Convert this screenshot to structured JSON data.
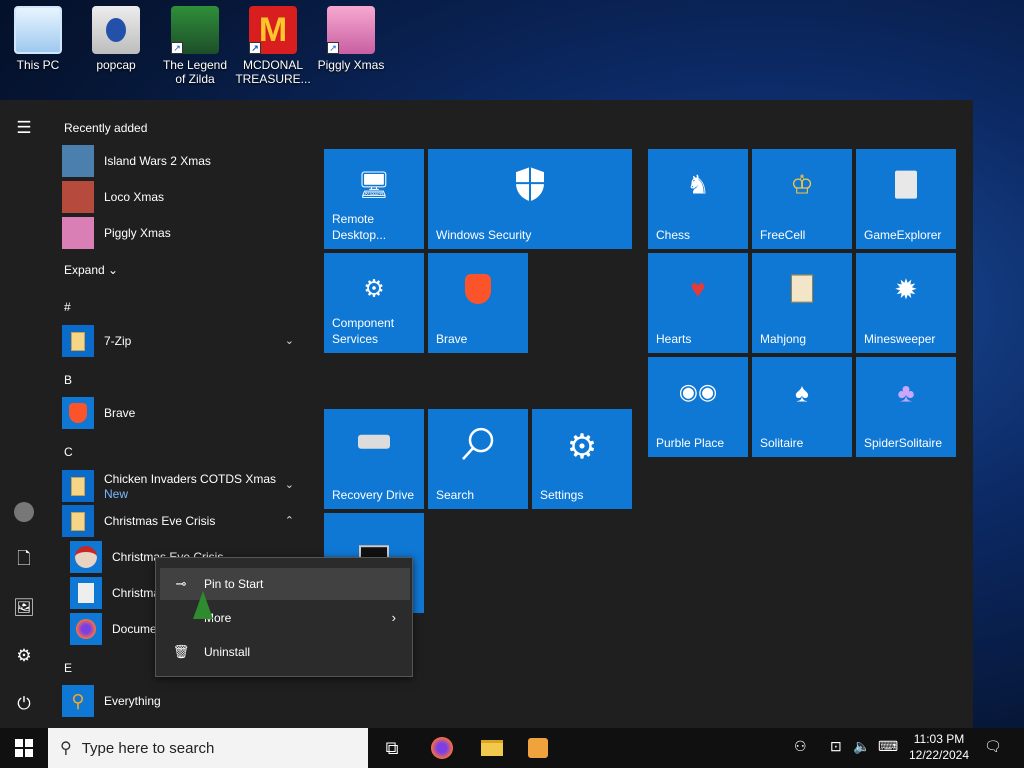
{
  "desktop": {
    "icons": [
      {
        "label": "This PC"
      },
      {
        "label": "popcap"
      },
      {
        "label": "The Legend of Zilda"
      },
      {
        "label": "MCDONAL TREASURE..."
      },
      {
        "label": "Piggly Xmas"
      }
    ]
  },
  "start_menu": {
    "recently_added_header": "Recently added",
    "recent_apps": [
      {
        "label": "Island Wars 2 Xmas"
      },
      {
        "label": "Loco Xmas"
      },
      {
        "label": "Piggly Xmas"
      }
    ],
    "expand_label": "Expand",
    "sections": {
      "hash": "#",
      "b": "B",
      "c": "C",
      "e": "E"
    },
    "apps": {
      "seven_zip": "7-Zip",
      "brave": "Brave",
      "chicken_invaders": "Chicken Invaders COTDS Xmas",
      "chicken_invaders_badge": "New",
      "christmas_eve_crisis": "Christmas Eve Crisis",
      "sub1": "Christmas Eve Crisis",
      "sub2": "Christmas...",
      "sub3": "Documentation",
      "everything": "Everything"
    },
    "tiles": [
      {
        "label": "Remote Desktop...",
        "icon": "remote-desktop-icon"
      },
      {
        "label": "Windows Security",
        "icon": "shield-icon"
      },
      {
        "label": "Component Services",
        "icon": "component-services-icon"
      },
      {
        "label": "Brave",
        "icon": "brave-icon"
      },
      {
        "label": "Recovery Drive",
        "icon": "drive-icon"
      },
      {
        "label": "Search",
        "icon": "search-icon"
      },
      {
        "label": "Settings",
        "icon": "gear-icon"
      },
      {
        "label": "Chess",
        "icon": "chess-icon"
      },
      {
        "label": "FreeCell",
        "icon": "freecell-icon"
      },
      {
        "label": "GameExplorer",
        "icon": "game-explorer-icon"
      },
      {
        "label": "Hearts",
        "icon": "hearts-icon"
      },
      {
        "label": "Mahjong",
        "icon": "mahjong-icon"
      },
      {
        "label": "Minesweeper",
        "icon": "mine-icon"
      },
      {
        "label": "Purble Place",
        "icon": "purble-icon"
      },
      {
        "label": "Solitaire",
        "icon": "solitaire-icon"
      },
      {
        "label": "SpiderSolitaire",
        "icon": "spider-solitaire-icon"
      }
    ]
  },
  "context_menu": {
    "items": [
      {
        "label": "Pin to Start"
      },
      {
        "label": "More"
      },
      {
        "label": "Uninstall"
      }
    ]
  },
  "taskbar": {
    "search_placeholder": "Type here to search",
    "clock_time": "11:03 PM",
    "clock_date": "12/22/2024"
  },
  "colors": {
    "tile_blue": "#0f78d4",
    "menu_bg": "#1f1f1f",
    "taskbar_bg": "#101010"
  }
}
